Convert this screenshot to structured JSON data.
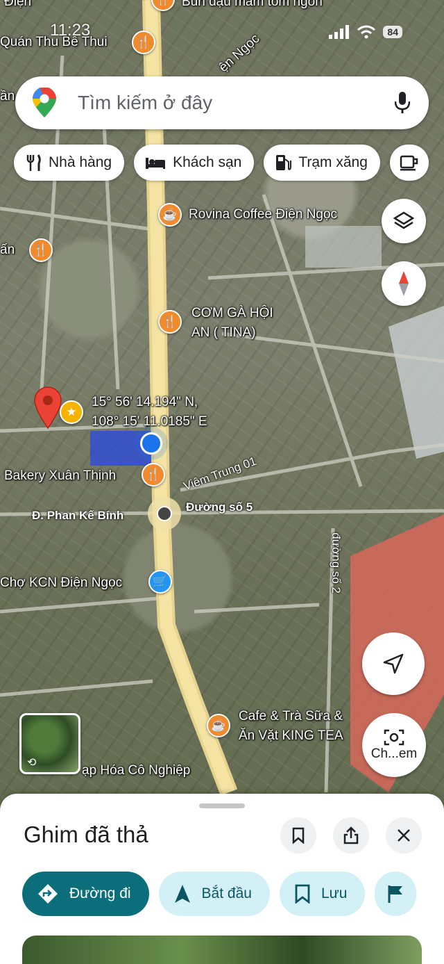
{
  "status_bar": {
    "time": "11:23",
    "battery": "84"
  },
  "search": {
    "placeholder": "Tìm kiếm ở đây"
  },
  "chips": [
    {
      "label": "Nhà hàng",
      "icon": "restaurant-icon"
    },
    {
      "label": "Khách sạn",
      "icon": "hotel-icon"
    },
    {
      "label": "Trạm xăng",
      "icon": "gas-station-icon"
    }
  ],
  "map": {
    "places": {
      "quan_thu_be_thui": "Quán Thu Bê Thui",
      "bun_dau": "Bún đậu mắm tôm ngon",
      "rovina": "Rovina Coffee Điện Ngọc",
      "com_ga_line1": "CƠM GÀ HỘI",
      "com_ga_line2": "AN ( TINA)",
      "bakery": "Bakery Xuân Thịnh",
      "cho_kcn": "Chợ KCN Điện Ngọc",
      "cafe_line1": "Cafe & Trà Sữa &",
      "cafe_line2": "Ăn Vặt KING TEA",
      "tap_hoa": "ạp Hóa Cô Nghiệp",
      "left_edge_1": "ấn",
      "left_edge_2": "ần",
      "dien_ngoc": "ện Ngọc",
      "partial_top": "Điện"
    },
    "roads": {
      "phan_ke_binh": "Đ. Phan Kế Bính",
      "duong_so_5": "Đường số 5",
      "viem_trung": "Viêm Trung 01",
      "duong_so_2": "đường số 2"
    },
    "pin_coordinates": {
      "lat": "15° 56' 14.194\" N,",
      "lng": "108° 15' 11.0185\" E"
    }
  },
  "lens_button": {
    "label": "Ch...em"
  },
  "sheet": {
    "title": "Ghim đã thả",
    "actions": [
      {
        "label": "Đường đi",
        "icon": "directions-icon"
      },
      {
        "label": "Bắt đầu",
        "icon": "navigation-arrow-icon"
      },
      {
        "label": "Lưu",
        "icon": "bookmark-icon"
      }
    ]
  },
  "colors": {
    "road": "#f1d98a",
    "pin": "#ea4335",
    "primary": "#0b6e7a",
    "light": "#d3f0f7"
  }
}
